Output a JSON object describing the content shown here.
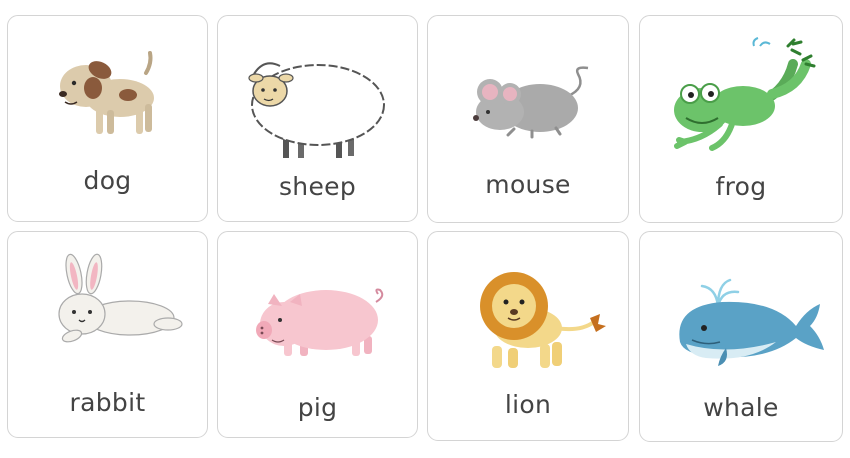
{
  "cards": [
    {
      "label": "dog",
      "icon": "dog-icon"
    },
    {
      "label": "sheep",
      "icon": "sheep-icon"
    },
    {
      "label": "mouse",
      "icon": "mouse-icon"
    },
    {
      "label": "frog",
      "icon": "frog-icon"
    },
    {
      "label": "rabbit",
      "icon": "rabbit-icon"
    },
    {
      "label": "pig",
      "icon": "pig-icon"
    },
    {
      "label": "lion",
      "icon": "lion-icon"
    },
    {
      "label": "whale",
      "icon": "whale-icon"
    }
  ],
  "colors": {
    "card_border": "#d4d4d4",
    "label_text": "#444444",
    "dog": "#d9c7a8",
    "sheep_wool": "#ffffff",
    "mouse": "#a8a8a8",
    "frog": "#6cc36a",
    "rabbit": "#f3f1ec",
    "pig": "#f7c6cf",
    "lion_mane": "#d9902a",
    "whale": "#5aa2c6"
  }
}
